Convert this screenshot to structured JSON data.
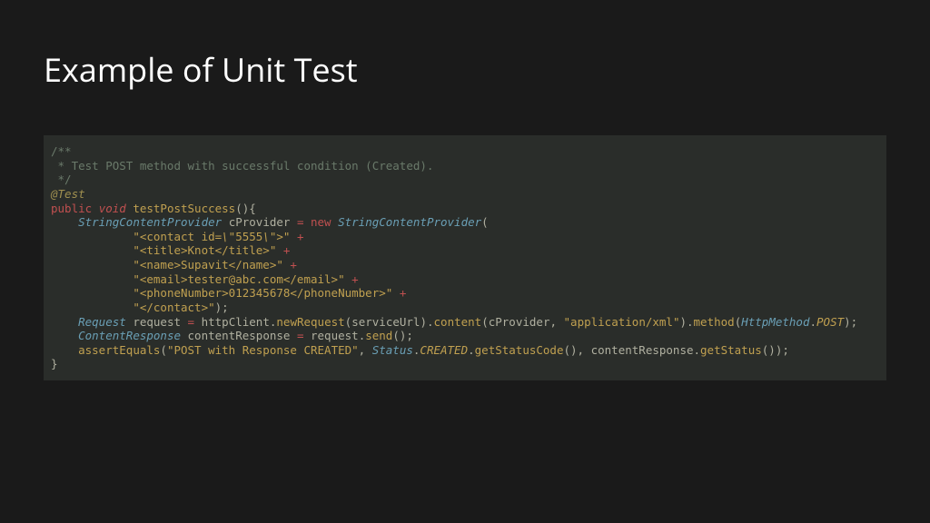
{
  "title": "Example of Unit Test",
  "code": {
    "comment1": "/**",
    "comment2": " * Test POST method with successful condition (Created).",
    "comment3": " */",
    "annotation": "@Test",
    "kwPublic": "public",
    "kwVoid": "void",
    "kwNew": "new",
    "fnName": "testPostSuccess",
    "tStringContentProvider": "StringContentProvider",
    "tRequest": "Request",
    "tContentResponse": "ContentResponse",
    "tStatus": "Status",
    "tHttpMethod": "HttpMethod",
    "vCProvider": "cProvider",
    "vRequest": "request",
    "vContentResponse": "contentResponse",
    "vHttpClient": "httpClient",
    "vServiceUrl": "serviceUrl",
    "s1a": "\"<contact id=",
    "s1b": "\\\"",
    "s1c": "5555",
    "s1d": "\\\"",
    "s1e": ">\"",
    "s2": "\"<title>Knot</title>\"",
    "s3": "\"<name>Supavit</name>\"",
    "s4": "\"<email>tester@abc.com</email>\"",
    "s5": "\"<phoneNumber>012345678</phoneNumber>\"",
    "s6": "\"</contact>\"",
    "sAppXml": "\"application/xml\"",
    "sPostMsg": "\"POST with Response CREATED\"",
    "mNewRequest": "newRequest",
    "mContent": "content",
    "mMethod": "method",
    "mSend": "send",
    "mGetStatusCode": "getStatusCode",
    "mGetStatus": "getStatus",
    "mAssertEquals": "assertEquals",
    "cCREATED": "CREATED",
    "cPOST": "POST",
    "plus": " +",
    "eq": " = ",
    "parenOpen": "(",
    "parenClose": ")",
    "parenOpenClose": "()",
    "braceOpen": "{",
    "braceClose": "}",
    "semi": ";",
    "comma": ", ",
    "dot": ".",
    "sp": " "
  }
}
